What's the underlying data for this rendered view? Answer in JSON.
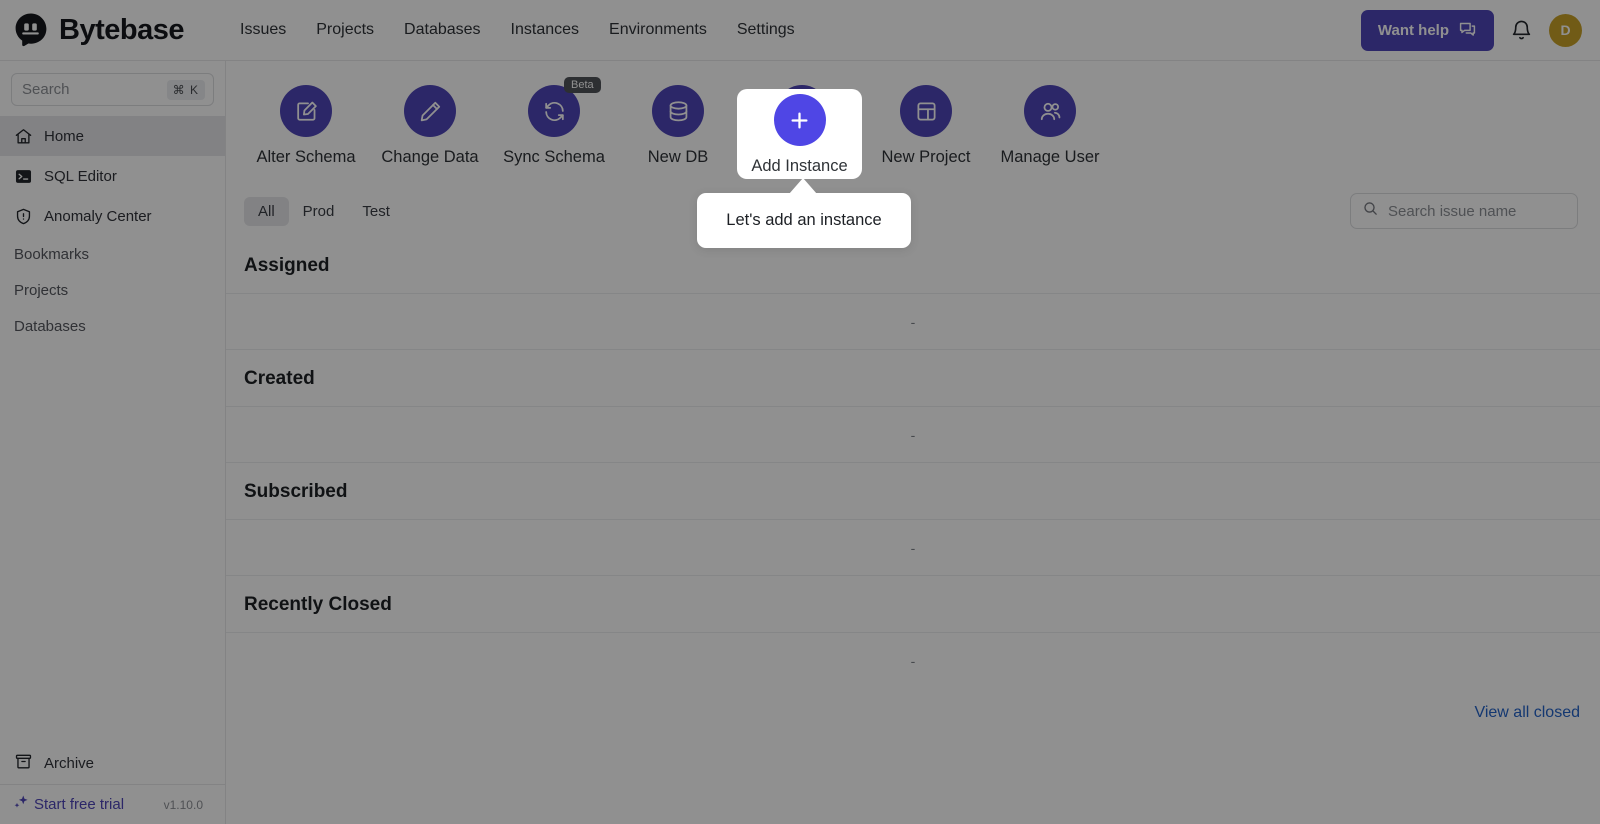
{
  "app": {
    "brand_name": "Bytebase",
    "version": "v1.10.0"
  },
  "topnav": {
    "items": [
      {
        "label": "Issues"
      },
      {
        "label": "Projects"
      },
      {
        "label": "Databases"
      },
      {
        "label": "Instances"
      },
      {
        "label": "Environments"
      },
      {
        "label": "Settings"
      }
    ],
    "help_button": "Want help",
    "avatar_initial": "D"
  },
  "sidebar": {
    "search": {
      "placeholder": "Search",
      "shortcut": "⌘ K"
    },
    "items": [
      {
        "label": "Home",
        "icon": "home-icon",
        "active": true
      },
      {
        "label": "SQL Editor",
        "icon": "terminal-icon",
        "active": false
      },
      {
        "label": "Anomaly Center",
        "icon": "shield-alert-icon",
        "active": false
      }
    ],
    "plain_items": [
      {
        "label": "Bookmarks"
      },
      {
        "label": "Projects"
      },
      {
        "label": "Databases"
      }
    ],
    "archive": "Archive",
    "trial": "Start free trial"
  },
  "quick_actions": [
    {
      "label": "Alter Schema",
      "icon": "edit-square-icon",
      "badge": null
    },
    {
      "label": "Change Data",
      "icon": "pencil-icon",
      "badge": null
    },
    {
      "label": "Sync Schema",
      "icon": "sync-icon",
      "badge": "Beta"
    },
    {
      "label": "New DB",
      "icon": "database-icon",
      "badge": null
    },
    {
      "label": "Add Instance",
      "icon": "plus-icon",
      "badge": null
    },
    {
      "label": "New Project",
      "icon": "layout-icon",
      "badge": null
    },
    {
      "label": "Manage User",
      "icon": "users-icon",
      "badge": null
    }
  ],
  "filters": {
    "tabs": [
      {
        "label": "All",
        "active": true
      },
      {
        "label": "Prod",
        "active": false
      },
      {
        "label": "Test",
        "active": false
      }
    ],
    "search_placeholder": "Search issue name"
  },
  "sections": [
    {
      "title": "Assigned",
      "empty_text": "-"
    },
    {
      "title": "Created",
      "empty_text": "-"
    },
    {
      "title": "Subscribed",
      "empty_text": "-"
    },
    {
      "title": "Recently Closed",
      "empty_text": "-"
    }
  ],
  "view_all_closed": "View all closed",
  "tour": {
    "highlight_label": "Add Instance",
    "tooltip_text": "Let's add an instance"
  },
  "colors": {
    "brand_purple": "#4f46b8",
    "accent_blue": "#4f46e5",
    "link_blue": "#2563c9",
    "avatar_gold": "#c9a227"
  }
}
